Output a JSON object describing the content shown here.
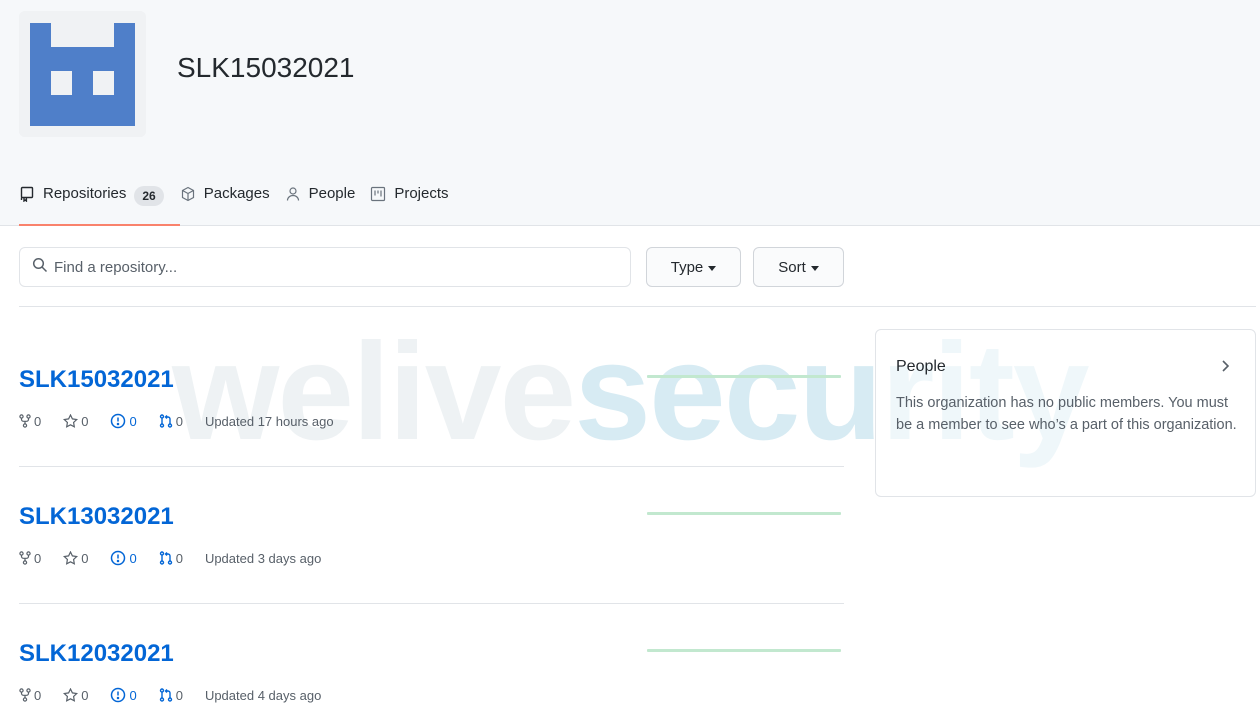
{
  "org": {
    "name": "SLK15032021"
  },
  "tabs": [
    {
      "label": "Repositories",
      "count": "26",
      "icon": "repo-icon"
    },
    {
      "label": "Packages",
      "icon": "package-icon"
    },
    {
      "label": "People",
      "icon": "person-icon"
    },
    {
      "label": "Projects",
      "icon": "project-icon"
    }
  ],
  "search": {
    "placeholder": "Find a repository..."
  },
  "filters": {
    "type_label": "Type",
    "sort_label": "Sort"
  },
  "repos": [
    {
      "name": "SLK15032021",
      "forks": "0",
      "stars": "0",
      "issues": "0",
      "pulls": "0",
      "updated": "Updated 17 hours ago"
    },
    {
      "name": "SLK13032021",
      "forks": "0",
      "stars": "0",
      "issues": "0",
      "pulls": "0",
      "updated": "Updated 3 days ago"
    },
    {
      "name": "SLK12032021",
      "forks": "0",
      "stars": "0",
      "issues": "0",
      "pulls": "0",
      "updated": "Updated 4 days ago"
    }
  ],
  "people_panel": {
    "title": "People",
    "text": "This organization has no public members. You must be a member to see who’s a part of this organization."
  },
  "watermark": {
    "part1": "welive",
    "part2": "security"
  },
  "colors": {
    "accent": "#0366d6",
    "selected_tab": "#f9826c",
    "issue_icon": "#0366d6",
    "avatar_blue": "#4f7fc9",
    "graph": "#c2e8cf"
  }
}
